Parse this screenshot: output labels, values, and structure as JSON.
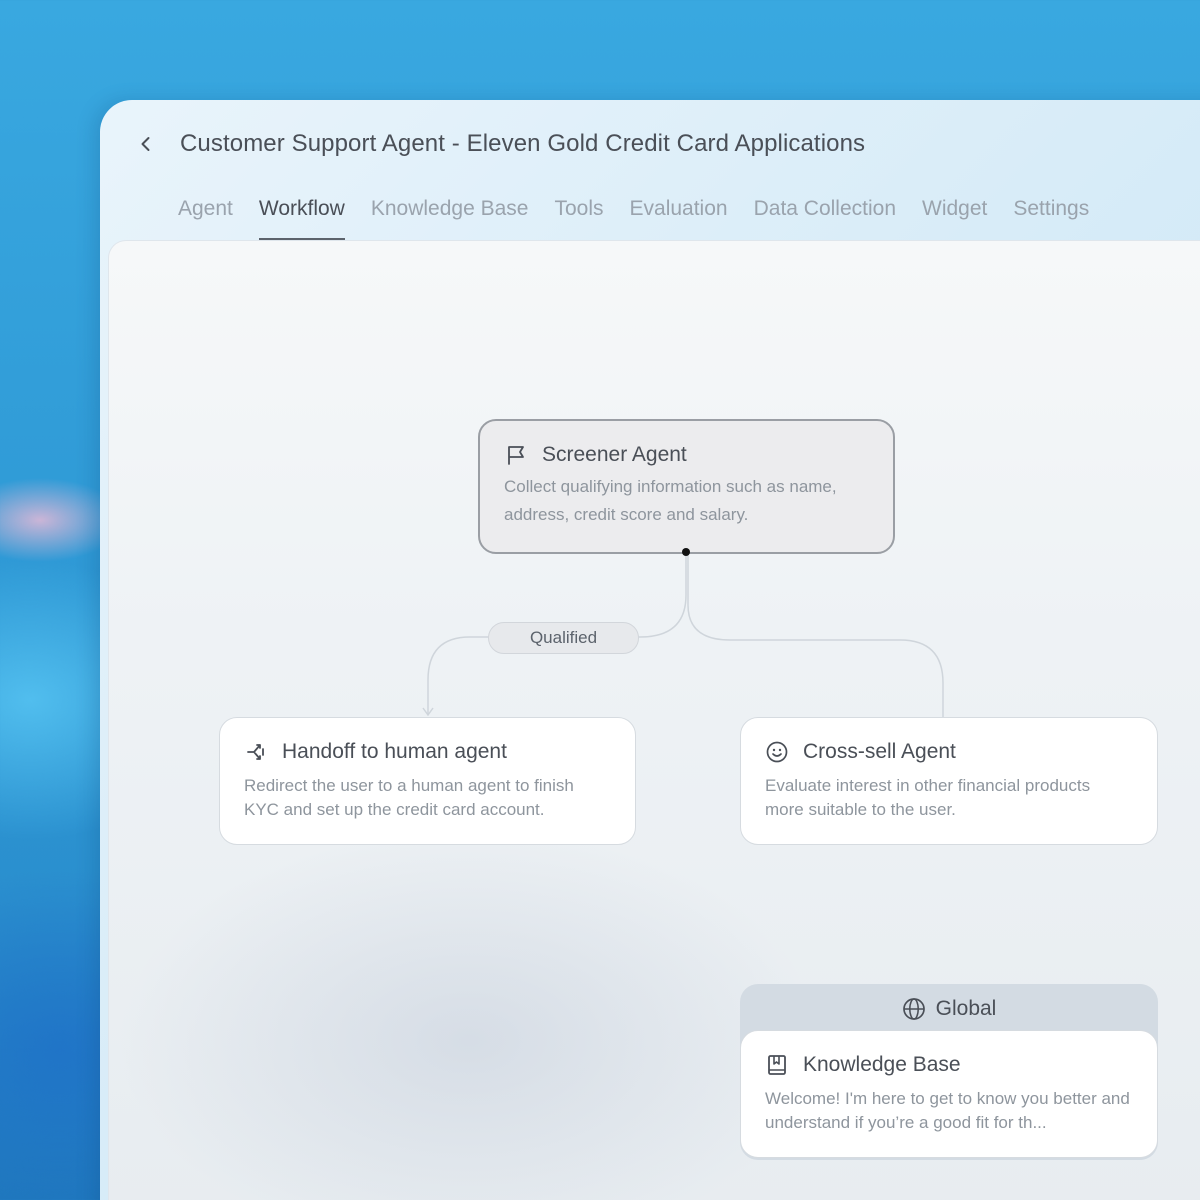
{
  "header": {
    "title": "Customer Support Agent - Eleven Gold Credit Card Applications",
    "back_icon": "chevron-left-icon"
  },
  "tabs": [
    {
      "label": "Agent",
      "active": false
    },
    {
      "label": "Workflow",
      "active": true
    },
    {
      "label": "Knowledge Base",
      "active": false
    },
    {
      "label": "Tools",
      "active": false
    },
    {
      "label": "Evaluation",
      "active": false
    },
    {
      "label": "Data Collection",
      "active": false
    },
    {
      "label": "Widget",
      "active": false
    },
    {
      "label": "Settings",
      "active": false
    }
  ],
  "workflow": {
    "screener": {
      "icon": "flag-icon",
      "title": "Screener Agent",
      "description": "Collect qualifying information such as name, address, credit score and salary."
    },
    "edge_label": "Qualified",
    "handoff": {
      "icon": "handoff-icon",
      "title": "Handoff to human agent",
      "description": "Redirect the user to a human agent to finish KYC and set up the credit card account."
    },
    "crosssell": {
      "icon": "smiley-icon",
      "title": "Cross-sell Agent",
      "description": "Evaluate interest in other financial products more suitable to the user."
    },
    "global": {
      "icon": "globe-icon",
      "label": "Global",
      "knowledge_base": {
        "icon": "book-icon",
        "title": "Knowledge Base",
        "description": "Welcome! I'm here to get to know you better and understand if you’re a good fit for th..."
      }
    }
  },
  "colors": {
    "background": "#2f9ad6",
    "text_primary": "#4a4f57",
    "text_muted": "#8e959d",
    "tab_inactive": "#9aa3ad",
    "edge": "#cfd5db"
  }
}
